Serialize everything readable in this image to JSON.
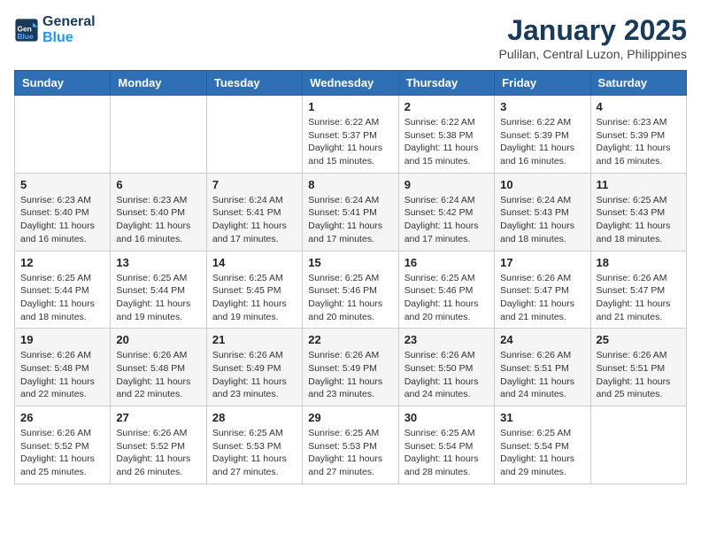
{
  "header": {
    "logo_line1": "General",
    "logo_line2": "Blue",
    "month": "January 2025",
    "location": "Pulilan, Central Luzon, Philippines"
  },
  "weekdays": [
    "Sunday",
    "Monday",
    "Tuesday",
    "Wednesday",
    "Thursday",
    "Friday",
    "Saturday"
  ],
  "weeks": [
    [
      null,
      null,
      null,
      {
        "day": 1,
        "sunrise": "6:22 AM",
        "sunset": "5:37 PM",
        "daylight": "11 hours and 15 minutes."
      },
      {
        "day": 2,
        "sunrise": "6:22 AM",
        "sunset": "5:38 PM",
        "daylight": "11 hours and 15 minutes."
      },
      {
        "day": 3,
        "sunrise": "6:22 AM",
        "sunset": "5:39 PM",
        "daylight": "11 hours and 16 minutes."
      },
      {
        "day": 4,
        "sunrise": "6:23 AM",
        "sunset": "5:39 PM",
        "daylight": "11 hours and 16 minutes."
      }
    ],
    [
      {
        "day": 5,
        "sunrise": "6:23 AM",
        "sunset": "5:40 PM",
        "daylight": "11 hours and 16 minutes."
      },
      {
        "day": 6,
        "sunrise": "6:23 AM",
        "sunset": "5:40 PM",
        "daylight": "11 hours and 16 minutes."
      },
      {
        "day": 7,
        "sunrise": "6:24 AM",
        "sunset": "5:41 PM",
        "daylight": "11 hours and 17 minutes."
      },
      {
        "day": 8,
        "sunrise": "6:24 AM",
        "sunset": "5:41 PM",
        "daylight": "11 hours and 17 minutes."
      },
      {
        "day": 9,
        "sunrise": "6:24 AM",
        "sunset": "5:42 PM",
        "daylight": "11 hours and 17 minutes."
      },
      {
        "day": 10,
        "sunrise": "6:24 AM",
        "sunset": "5:43 PM",
        "daylight": "11 hours and 18 minutes."
      },
      {
        "day": 11,
        "sunrise": "6:25 AM",
        "sunset": "5:43 PM",
        "daylight": "11 hours and 18 minutes."
      }
    ],
    [
      {
        "day": 12,
        "sunrise": "6:25 AM",
        "sunset": "5:44 PM",
        "daylight": "11 hours and 18 minutes."
      },
      {
        "day": 13,
        "sunrise": "6:25 AM",
        "sunset": "5:44 PM",
        "daylight": "11 hours and 19 minutes."
      },
      {
        "day": 14,
        "sunrise": "6:25 AM",
        "sunset": "5:45 PM",
        "daylight": "11 hours and 19 minutes."
      },
      {
        "day": 15,
        "sunrise": "6:25 AM",
        "sunset": "5:46 PM",
        "daylight": "11 hours and 20 minutes."
      },
      {
        "day": 16,
        "sunrise": "6:25 AM",
        "sunset": "5:46 PM",
        "daylight": "11 hours and 20 minutes."
      },
      {
        "day": 17,
        "sunrise": "6:26 AM",
        "sunset": "5:47 PM",
        "daylight": "11 hours and 21 minutes."
      },
      {
        "day": 18,
        "sunrise": "6:26 AM",
        "sunset": "5:47 PM",
        "daylight": "11 hours and 21 minutes."
      }
    ],
    [
      {
        "day": 19,
        "sunrise": "6:26 AM",
        "sunset": "5:48 PM",
        "daylight": "11 hours and 22 minutes."
      },
      {
        "day": 20,
        "sunrise": "6:26 AM",
        "sunset": "5:48 PM",
        "daylight": "11 hours and 22 minutes."
      },
      {
        "day": 21,
        "sunrise": "6:26 AM",
        "sunset": "5:49 PM",
        "daylight": "11 hours and 23 minutes."
      },
      {
        "day": 22,
        "sunrise": "6:26 AM",
        "sunset": "5:49 PM",
        "daylight": "11 hours and 23 minutes."
      },
      {
        "day": 23,
        "sunrise": "6:26 AM",
        "sunset": "5:50 PM",
        "daylight": "11 hours and 24 minutes."
      },
      {
        "day": 24,
        "sunrise": "6:26 AM",
        "sunset": "5:51 PM",
        "daylight": "11 hours and 24 minutes."
      },
      {
        "day": 25,
        "sunrise": "6:26 AM",
        "sunset": "5:51 PM",
        "daylight": "11 hours and 25 minutes."
      }
    ],
    [
      {
        "day": 26,
        "sunrise": "6:26 AM",
        "sunset": "5:52 PM",
        "daylight": "11 hours and 25 minutes."
      },
      {
        "day": 27,
        "sunrise": "6:26 AM",
        "sunset": "5:52 PM",
        "daylight": "11 hours and 26 minutes."
      },
      {
        "day": 28,
        "sunrise": "6:25 AM",
        "sunset": "5:53 PM",
        "daylight": "11 hours and 27 minutes."
      },
      {
        "day": 29,
        "sunrise": "6:25 AM",
        "sunset": "5:53 PM",
        "daylight": "11 hours and 27 minutes."
      },
      {
        "day": 30,
        "sunrise": "6:25 AM",
        "sunset": "5:54 PM",
        "daylight": "11 hours and 28 minutes."
      },
      {
        "day": 31,
        "sunrise": "6:25 AM",
        "sunset": "5:54 PM",
        "daylight": "11 hours and 29 minutes."
      },
      null
    ]
  ]
}
